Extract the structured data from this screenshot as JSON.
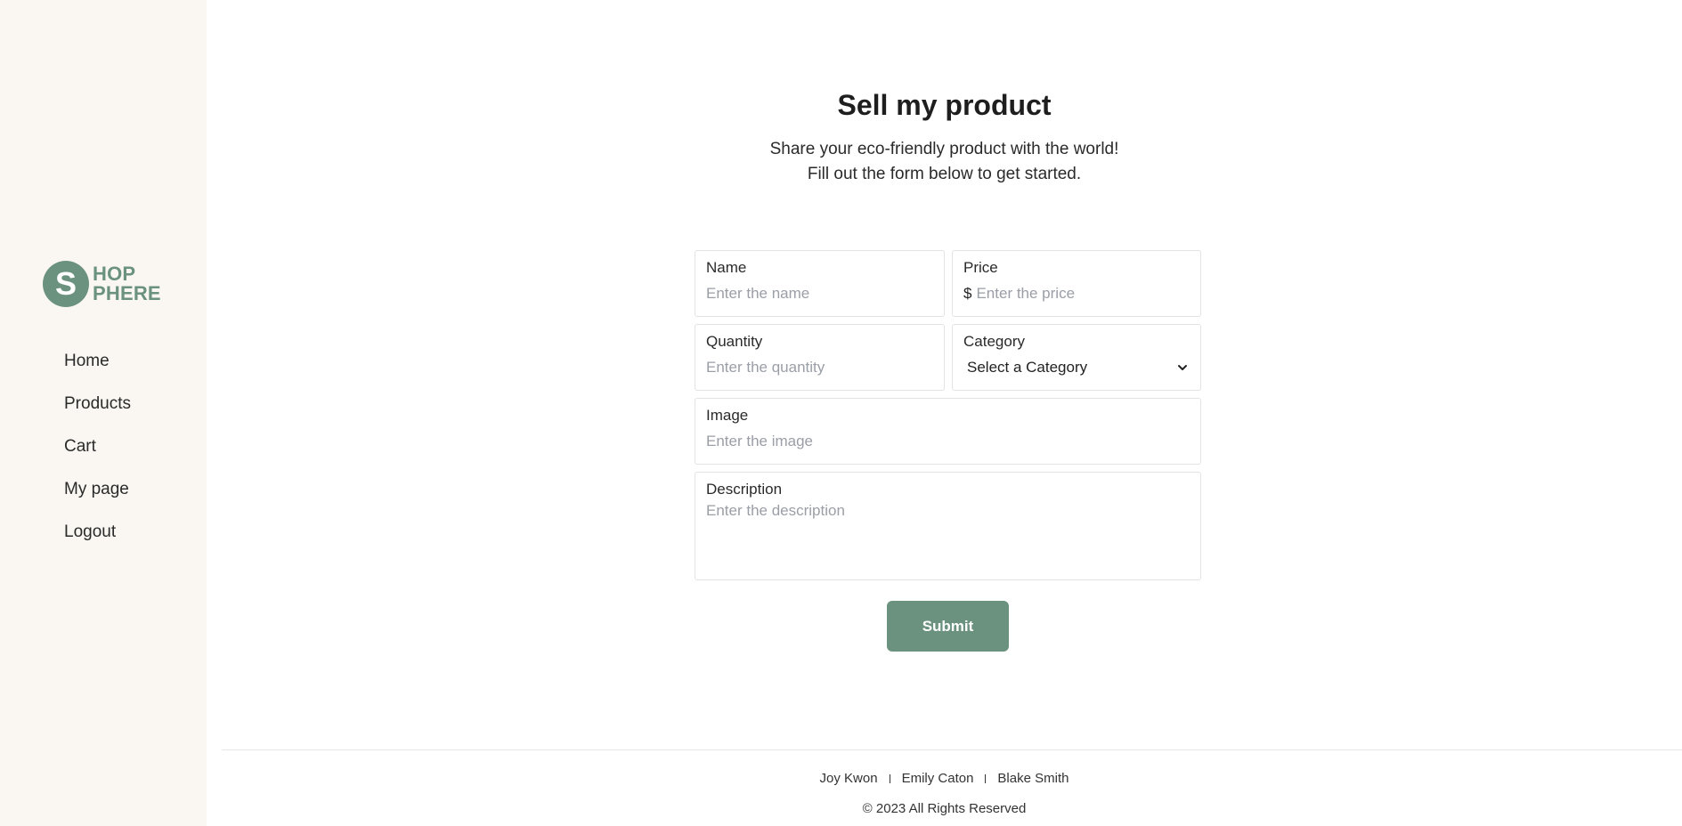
{
  "brand": {
    "logo_letter": "S",
    "logo_line1": "HOP",
    "logo_line2": "PHERE",
    "color": "#6b927f"
  },
  "sidebar": {
    "items": [
      {
        "label": "Home"
      },
      {
        "label": "Products"
      },
      {
        "label": "Cart"
      },
      {
        "label": "My page"
      },
      {
        "label": "Logout"
      }
    ]
  },
  "page": {
    "title": "Sell my product",
    "subtitle_line1": "Share your eco-friendly product with the world!",
    "subtitle_line2": "Fill out the form below to get started."
  },
  "form": {
    "name": {
      "label": "Name",
      "placeholder": "Enter the name",
      "value": ""
    },
    "price": {
      "label": "Price",
      "currency": "$",
      "placeholder": "Enter the price",
      "value": ""
    },
    "quantity": {
      "label": "Quantity",
      "placeholder": "Enter the quantity",
      "value": ""
    },
    "category": {
      "label": "Category",
      "selected": "Select a Category"
    },
    "image": {
      "label": "Image",
      "placeholder": "Enter the image",
      "value": ""
    },
    "description": {
      "label": "Description",
      "placeholder": "Enter the description",
      "value": ""
    },
    "submit_label": "Submit"
  },
  "footer": {
    "names": [
      "Joy Kwon",
      "Emily Caton",
      "Blake Smith"
    ],
    "copyright": "© 2023 All Rights Reserved"
  },
  "colors": {
    "sidebar_bg": "#faf7f2",
    "accent": "#6b927f"
  }
}
